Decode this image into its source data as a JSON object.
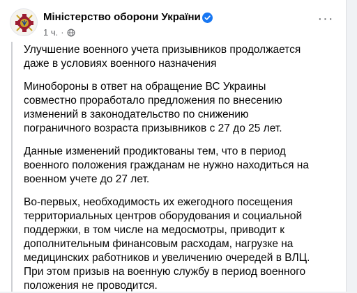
{
  "post": {
    "page_name": "Міністерство оборони України",
    "timestamp": "1 ч.",
    "separator": "·",
    "more_label": "···",
    "paragraphs": [
      "Улучшение военного учета призывников продолжается даже в условиях военного назначения",
      "Минобороны в ответ на обращение ВС Украины совместно проработало предложения по внесению изменений в законодательство по снижению пограничного возраста призывников с 27 до 25 лет.",
      "Данные изменений продиктованы тем, что в период военного положения гражданам не нужно находиться на военном учете до 27 лет.",
      "Во-первых, необходимость их ежегодного посещения территориальных центров оборудования и социальной поддержки, в том числе на медосмотры, приводит к дополнительным финансовым расходам, нагрузке на медицинских работников и увеличению очередей в ВЛЦ. При этом призыв на военную службу в период военного положения не проводится."
    ]
  },
  "icons": {
    "avatar": "ministry-emblem",
    "verified": "verified-badge-icon",
    "audience": "globe-icon",
    "more": "more-options-icon"
  },
  "colors": {
    "verified_blue": "#1877f2",
    "text": "#050505",
    "secondary_text": "#65676b",
    "emblem_red": "#9b1b30",
    "emblem_gold": "#c9a227",
    "quote_bar": "#ced0d4"
  }
}
